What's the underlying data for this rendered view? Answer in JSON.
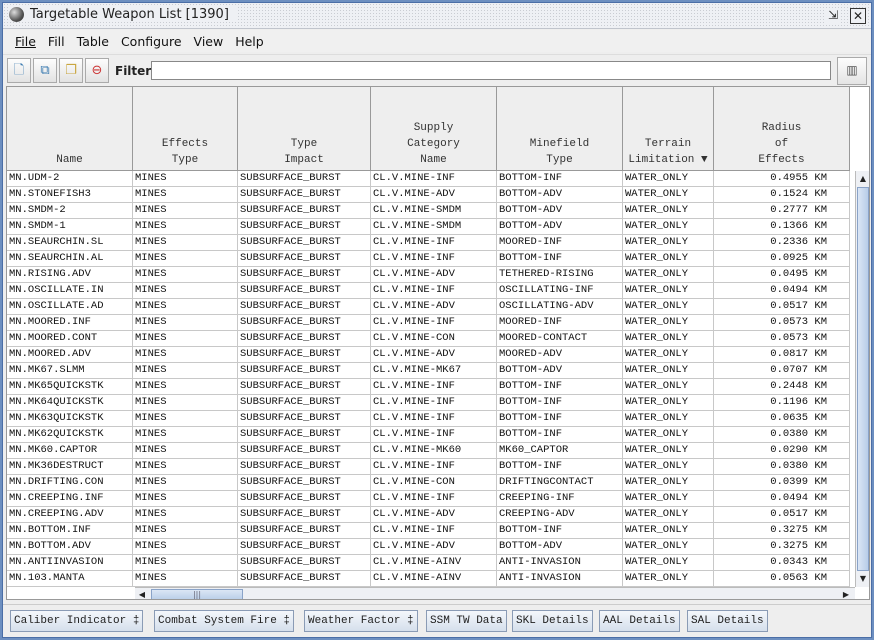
{
  "window": {
    "title": "Targetable Weapon List [1390]"
  },
  "menu": [
    "File",
    "Fill",
    "Table",
    "Configure",
    "View",
    "Help"
  ],
  "toolbar": {
    "filter_label": "Filter:",
    "filter_value": "",
    "icons": [
      "new-document-icon",
      "copy-document-icon",
      "multi-copy-icon",
      "delete-document-icon"
    ]
  },
  "table": {
    "columns": [
      "Name",
      "Effects\nType",
      "Type\nImpact",
      "Supply\nCategory\nName",
      "Minefield\nType",
      "Terrain\nLimitation ▼",
      "Radius\nof\nEffects"
    ],
    "rows": [
      [
        "MN.UDM-2",
        "MINES",
        "SUBSURFACE_BURST",
        "CL.V.MINE-INF",
        "BOTTOM-INF",
        "WATER_ONLY",
        "0.4955 KM"
      ],
      [
        "MN.STONEFISH3",
        "MINES",
        "SUBSURFACE_BURST",
        "CL.V.MINE-ADV",
        "BOTTOM-ADV",
        "WATER_ONLY",
        "0.1524 KM"
      ],
      [
        "MN.SMDM-2",
        "MINES",
        "SUBSURFACE_BURST",
        "CL.V.MINE-SMDM",
        "BOTTOM-ADV",
        "WATER_ONLY",
        "0.2777 KM"
      ],
      [
        "MN.SMDM-1",
        "MINES",
        "SUBSURFACE_BURST",
        "CL.V.MINE-SMDM",
        "BOTTOM-ADV",
        "WATER_ONLY",
        "0.1366 KM"
      ],
      [
        "MN.SEAURCHIN.SL",
        "MINES",
        "SUBSURFACE_BURST",
        "CL.V.MINE-INF",
        "MOORED-INF",
        "WATER_ONLY",
        "0.2336 KM"
      ],
      [
        "MN.SEAURCHIN.AL",
        "MINES",
        "SUBSURFACE_BURST",
        "CL.V.MINE-INF",
        "BOTTOM-INF",
        "WATER_ONLY",
        "0.0925 KM"
      ],
      [
        "MN.RISING.ADV",
        "MINES",
        "SUBSURFACE_BURST",
        "CL.V.MINE-ADV",
        "TETHERED-RISING",
        "WATER_ONLY",
        "0.0495 KM"
      ],
      [
        "MN.OSCILLATE.IN",
        "MINES",
        "SUBSURFACE_BURST",
        "CL.V.MINE-INF",
        "OSCILLATING-INF",
        "WATER_ONLY",
        "0.0494 KM"
      ],
      [
        "MN.OSCILLATE.AD",
        "MINES",
        "SUBSURFACE_BURST",
        "CL.V.MINE-ADV",
        "OSCILLATING-ADV",
        "WATER_ONLY",
        "0.0517 KM"
      ],
      [
        "MN.MOORED.INF",
        "MINES",
        "SUBSURFACE_BURST",
        "CL.V.MINE-INF",
        "MOORED-INF",
        "WATER_ONLY",
        "0.0573 KM"
      ],
      [
        "MN.MOORED.CONT",
        "MINES",
        "SUBSURFACE_BURST",
        "CL.V.MINE-CON",
        "MOORED-CONTACT",
        "WATER_ONLY",
        "0.0573 KM"
      ],
      [
        "MN.MOORED.ADV",
        "MINES",
        "SUBSURFACE_BURST",
        "CL.V.MINE-ADV",
        "MOORED-ADV",
        "WATER_ONLY",
        "0.0817 KM"
      ],
      [
        "MN.MK67.SLMM",
        "MINES",
        "SUBSURFACE_BURST",
        "CL.V.MINE-MK67",
        "BOTTOM-ADV",
        "WATER_ONLY",
        "0.0707 KM"
      ],
      [
        "MN.MK65QUICKSTK",
        "MINES",
        "SUBSURFACE_BURST",
        "CL.V.MINE-INF",
        "BOTTOM-INF",
        "WATER_ONLY",
        "0.2448 KM"
      ],
      [
        "MN.MK64QUICKSTK",
        "MINES",
        "SUBSURFACE_BURST",
        "CL.V.MINE-INF",
        "BOTTOM-INF",
        "WATER_ONLY",
        "0.1196 KM"
      ],
      [
        "MN.MK63QUICKSTK",
        "MINES",
        "SUBSURFACE_BURST",
        "CL.V.MINE-INF",
        "BOTTOM-INF",
        "WATER_ONLY",
        "0.0635 KM"
      ],
      [
        "MN.MK62QUICKSTK",
        "MINES",
        "SUBSURFACE_BURST",
        "CL.V.MINE-INF",
        "BOTTOM-INF",
        "WATER_ONLY",
        "0.0380 KM"
      ],
      [
        "MN.MK60.CAPTOR",
        "MINES",
        "SUBSURFACE_BURST",
        "CL.V.MINE-MK60",
        "MK60_CAPTOR",
        "WATER_ONLY",
        "0.0290 KM"
      ],
      [
        "MN.MK36DESTRUCT",
        "MINES",
        "SUBSURFACE_BURST",
        "CL.V.MINE-INF",
        "BOTTOM-INF",
        "WATER_ONLY",
        "0.0380 KM"
      ],
      [
        "MN.DRIFTING.CON",
        "MINES",
        "SUBSURFACE_BURST",
        "CL.V.MINE-CON",
        "DRIFTINGCONTACT",
        "WATER_ONLY",
        "0.0399 KM"
      ],
      [
        "MN.CREEPING.INF",
        "MINES",
        "SUBSURFACE_BURST",
        "CL.V.MINE-INF",
        "CREEPING-INF",
        "WATER_ONLY",
        "0.0494 KM"
      ],
      [
        "MN.CREEPING.ADV",
        "MINES",
        "SUBSURFACE_BURST",
        "CL.V.MINE-ADV",
        "CREEPING-ADV",
        "WATER_ONLY",
        "0.0517 KM"
      ],
      [
        "MN.BOTTOM.INF",
        "MINES",
        "SUBSURFACE_BURST",
        "CL.V.MINE-INF",
        "BOTTOM-INF",
        "WATER_ONLY",
        "0.3275 KM"
      ],
      [
        "MN.BOTTOM.ADV",
        "MINES",
        "SUBSURFACE_BURST",
        "CL.V.MINE-ADV",
        "BOTTOM-ADV",
        "WATER_ONLY",
        "0.3275 KM"
      ],
      [
        "MN.ANTIINVASION",
        "MINES",
        "SUBSURFACE_BURST",
        "CL.V.MINE-AINV",
        "ANTI-INVASION",
        "WATER_ONLY",
        "0.0343 KM"
      ],
      [
        "MN.103.MANTA",
        "MINES",
        "SUBSURFACE_BURST",
        "CL.V.MINE-AINV",
        "ANTI-INVASION",
        "WATER_ONLY",
        "0.0563 KM"
      ]
    ]
  },
  "buttons": [
    "Caliber Indicator ‡",
    "Combat System Fire ‡",
    "Weather Factor ‡",
    "SSM TW Data",
    "SKL Details",
    "AAL Details",
    "SAL Details"
  ],
  "colors": {
    "window_border": "#4b6ea6",
    "scroll_thumb": "#b8cde8"
  }
}
